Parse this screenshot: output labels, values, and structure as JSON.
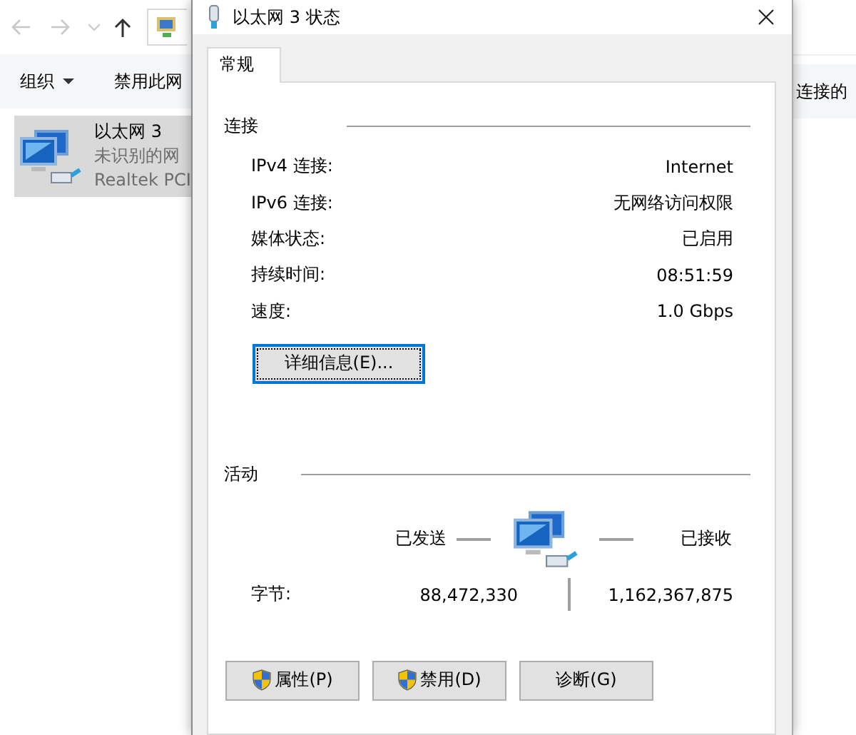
{
  "explorer": {
    "toolbar": [
      "组织",
      "禁用此网"
    ],
    "toolbar_right": "连接的",
    "item": {
      "name": "以太网 3",
      "status": "未识别的网",
      "adapter": "Realtek PCI",
      "selected": true
    }
  },
  "dialog": {
    "title": "以太网 3 状态",
    "tabs": [
      {
        "label": "常规",
        "selected": true
      }
    ],
    "connection": {
      "heading": "连接",
      "rows": [
        {
          "label": "IPv4 连接:",
          "value": "Internet"
        },
        {
          "label": "IPv6 连接:",
          "value": "无网络访问权限"
        },
        {
          "label": "媒体状态:",
          "value": "已启用"
        },
        {
          "label": "持续时间:",
          "value": "08:51:59"
        },
        {
          "label": "速度:",
          "value": "1.0 Gbps"
        }
      ]
    },
    "details_button": "详细信息(E)...",
    "activity": {
      "heading": "活动",
      "sent_label": "已发送",
      "received_label": "已接收",
      "bytes_label": "字节:",
      "bytes_sent": "88,472,330",
      "bytes_received": "1,162,367,875"
    },
    "buttons": [
      {
        "label": "属性(P)",
        "shield": true
      },
      {
        "label": "禁用(D)",
        "shield": true
      },
      {
        "label": "诊断(G)",
        "shield": false
      }
    ]
  }
}
